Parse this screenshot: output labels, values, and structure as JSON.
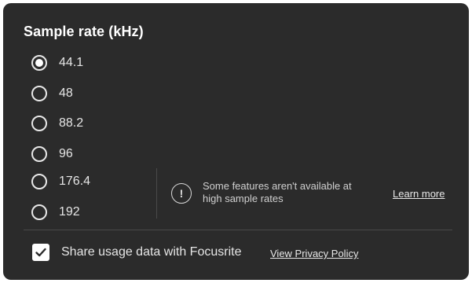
{
  "panel": {
    "title": "Sample rate (kHz)"
  },
  "sample_rates": {
    "selected": "44.1",
    "options": [
      {
        "label": "44.1",
        "selected": true
      },
      {
        "label": "48",
        "selected": false
      },
      {
        "label": "88.2",
        "selected": false
      },
      {
        "label": "96",
        "selected": false
      },
      {
        "label": "176.4",
        "selected": false
      },
      {
        "label": "192",
        "selected": false
      }
    ]
  },
  "notice": {
    "icon": "exclamation-circle-icon",
    "line1": "Some features aren't available at",
    "line2": "high sample rates",
    "link": "Learn more"
  },
  "share": {
    "checked": true,
    "label": "Share usage data with Focusrite",
    "link": "View Privacy Policy"
  },
  "colors": {
    "panel_background": "#2b2b2b",
    "text": "#e6e6e6",
    "divider": "#4a4a4a"
  }
}
